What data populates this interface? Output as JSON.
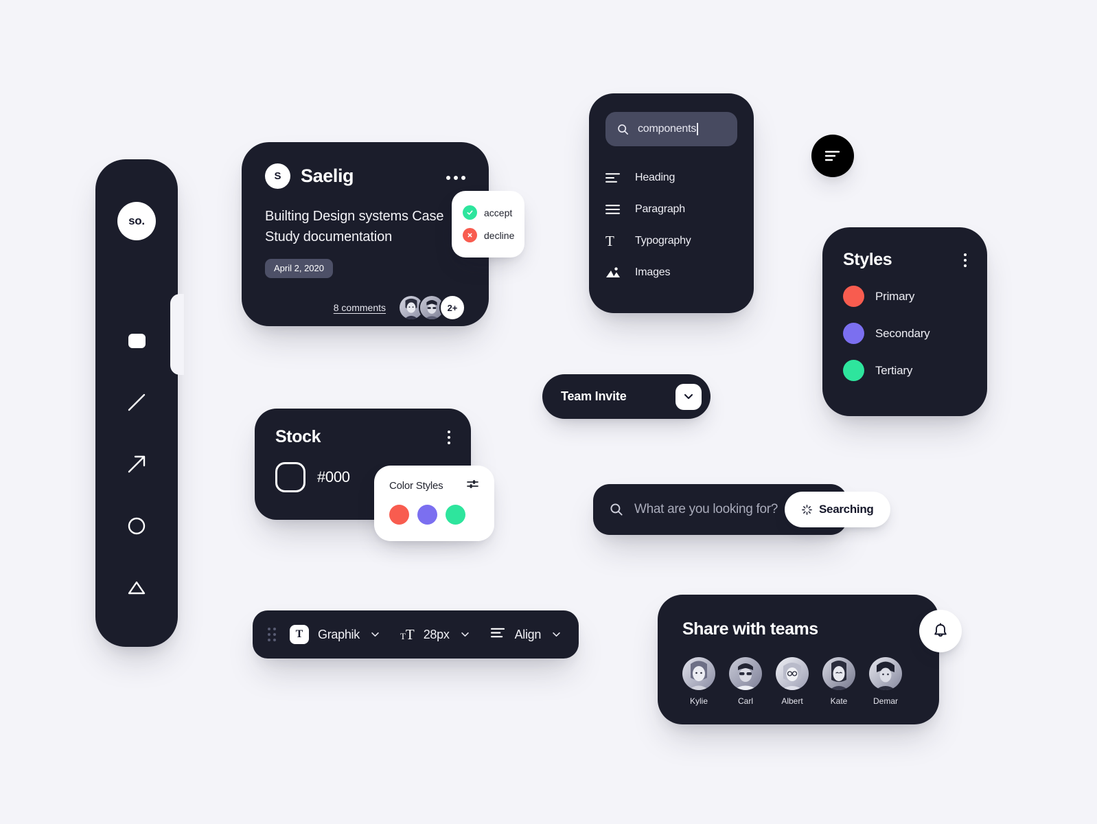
{
  "theme": {
    "background": "#f4f4f9",
    "surface_dark": "#1b1d2b",
    "surface_light": "#ffffff",
    "primary": "#f85c4f",
    "secondary": "#7b6ff0",
    "tertiary": "#2ee59d"
  },
  "sidebar": {
    "logo": "so.",
    "tools": [
      {
        "name": "rectangle-tool",
        "icon": "square-icon"
      },
      {
        "name": "line-tool",
        "icon": "line-icon"
      },
      {
        "name": "arrow-tool",
        "icon": "arrow-up-right-icon"
      },
      {
        "name": "ellipse-tool",
        "icon": "circle-icon"
      },
      {
        "name": "triangle-tool",
        "icon": "triangle-icon"
      }
    ]
  },
  "post_card": {
    "avatar_initial": "S",
    "author": "Saelig",
    "more_icon": "more-horizontal-icon",
    "title": "Builting Design systems Case Study documentation",
    "date": "April 2, 2020",
    "comments": "8 comments",
    "extra_avatars": "2+"
  },
  "accept_popup": {
    "items": [
      {
        "label": "accept",
        "icon": "check-icon",
        "color": "#2ee59d"
      },
      {
        "label": "decline",
        "icon": "close-icon",
        "color": "#f85c4f"
      }
    ]
  },
  "components_panel": {
    "search": {
      "value": "components",
      "placeholder": "Search",
      "icon": "search-icon"
    },
    "items": [
      {
        "label": "Heading",
        "icon": "heading-align-icon"
      },
      {
        "label": "Paragraph",
        "icon": "paragraph-lines-icon"
      },
      {
        "label": "Typography",
        "icon": "typography-t-icon"
      },
      {
        "label": "Images",
        "icon": "image-icon"
      }
    ]
  },
  "filter_fab": {
    "icon": "align-left-icon"
  },
  "styles_panel": {
    "title": "Styles",
    "menu_icon": "kebab-menu-icon",
    "items": [
      {
        "label": "Primary",
        "color": "#f85c4f"
      },
      {
        "label": "Secondary",
        "color": "#7b6ff0"
      },
      {
        "label": "Tertiary",
        "color": "#2ee59d"
      }
    ]
  },
  "team_invite": {
    "label": "Team Invite",
    "button_icon": "chevron-down-icon"
  },
  "stock_card": {
    "title": "Stock",
    "menu_icon": "kebab-menu-icon",
    "hex": "#000"
  },
  "color_styles": {
    "title": "Color Styles",
    "settings_icon": "sliders-icon",
    "swatches": [
      "#f85c4f",
      "#7b6ff0",
      "#2ee59d"
    ]
  },
  "big_search": {
    "icon": "search-icon",
    "placeholder": "What are you looking for?",
    "value": "",
    "button_label": "Searching",
    "button_icon": "spinner-icon"
  },
  "type_toolbar": {
    "grip_icon": "drag-grip-icon",
    "font": {
      "chip": "T",
      "label": "Graphik",
      "caret_icon": "chevron-down-icon"
    },
    "size": {
      "glyph": "TT",
      "label": "28px",
      "caret_icon": "chevron-down-icon"
    },
    "align": {
      "icon": "align-left-icon",
      "label": "Align",
      "caret_icon": "chevron-down-icon"
    }
  },
  "share_card": {
    "title": "Share with teams",
    "people": [
      {
        "name": "Kylie"
      },
      {
        "name": "Carl"
      },
      {
        "name": "Albert"
      },
      {
        "name": "Kate"
      },
      {
        "name": "Demar"
      }
    ]
  },
  "bell_fab": {
    "icon": "bell-icon"
  }
}
